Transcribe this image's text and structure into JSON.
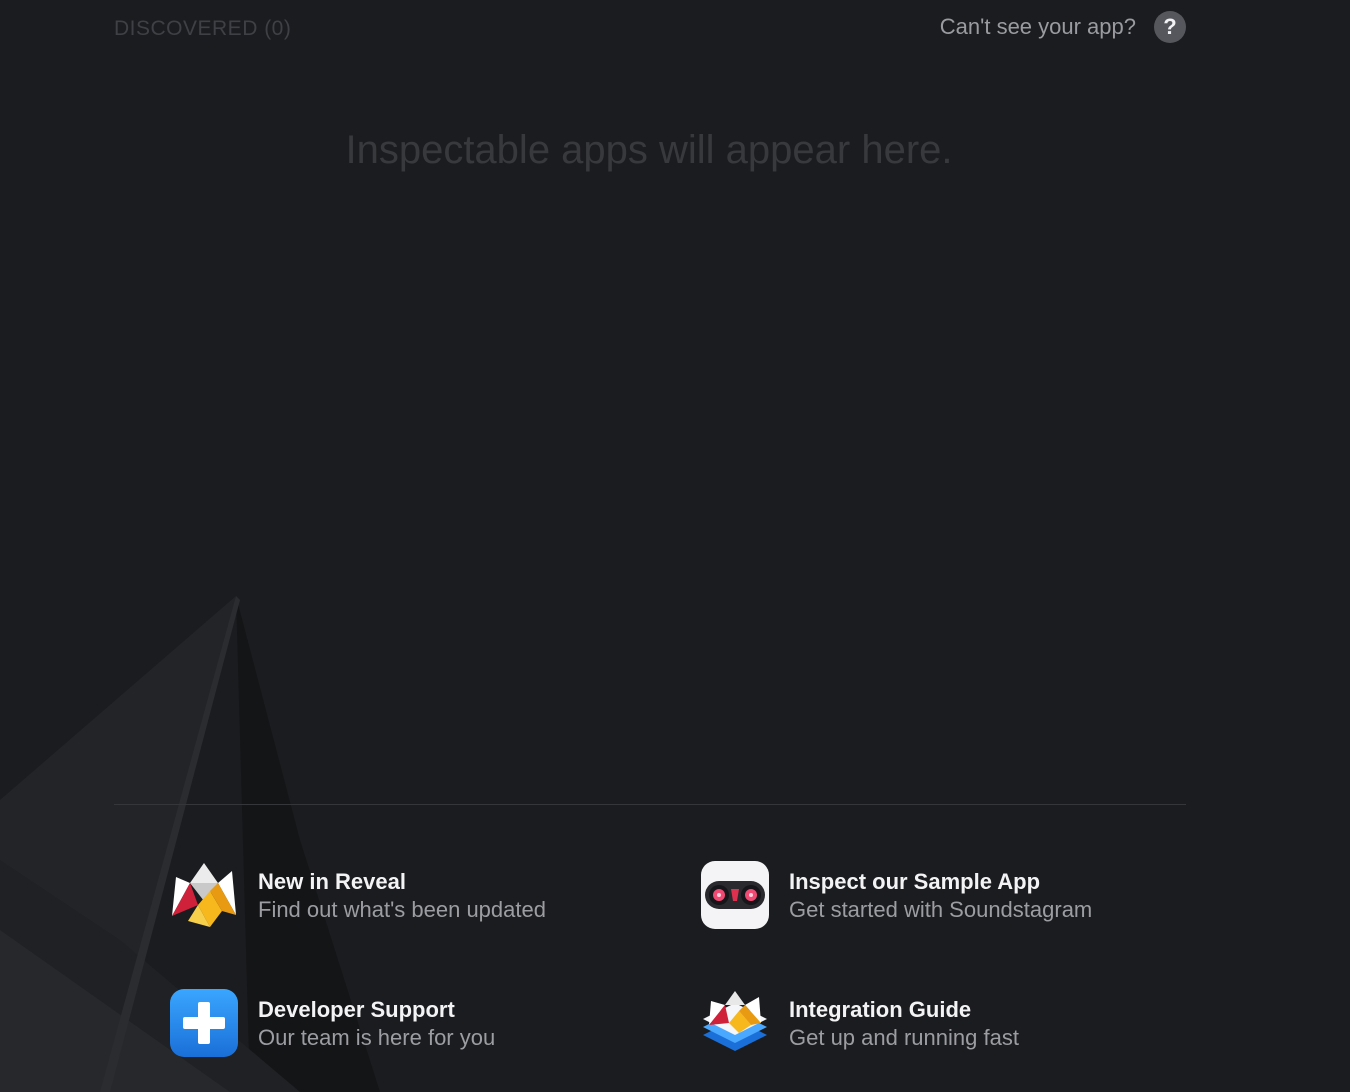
{
  "header": {
    "discovered_label": "DISCOVERED (0)",
    "help_text": "Can't see your app?",
    "help_button_label": "?"
  },
  "empty_state": {
    "message": "Inspectable apps will appear here."
  },
  "links": [
    {
      "title": "New in Reveal",
      "subtitle": "Find out what's been updated",
      "icon": "reveal-logo-icon"
    },
    {
      "title": "Inspect our Sample App",
      "subtitle": "Get started with Soundstagram",
      "icon": "soundstagram-icon"
    },
    {
      "title": "Developer Support",
      "subtitle": "Our team is here for you",
      "icon": "support-plus-icon"
    },
    {
      "title": "Integration Guide",
      "subtitle": "Get up and running fast",
      "icon": "integration-guide-icon"
    }
  ],
  "colors": {
    "background": "#1b1c1f",
    "accent_blue": "#1a7fe8",
    "reveal_red": "#d0213a",
    "reveal_yellow": "#f6b81c"
  }
}
